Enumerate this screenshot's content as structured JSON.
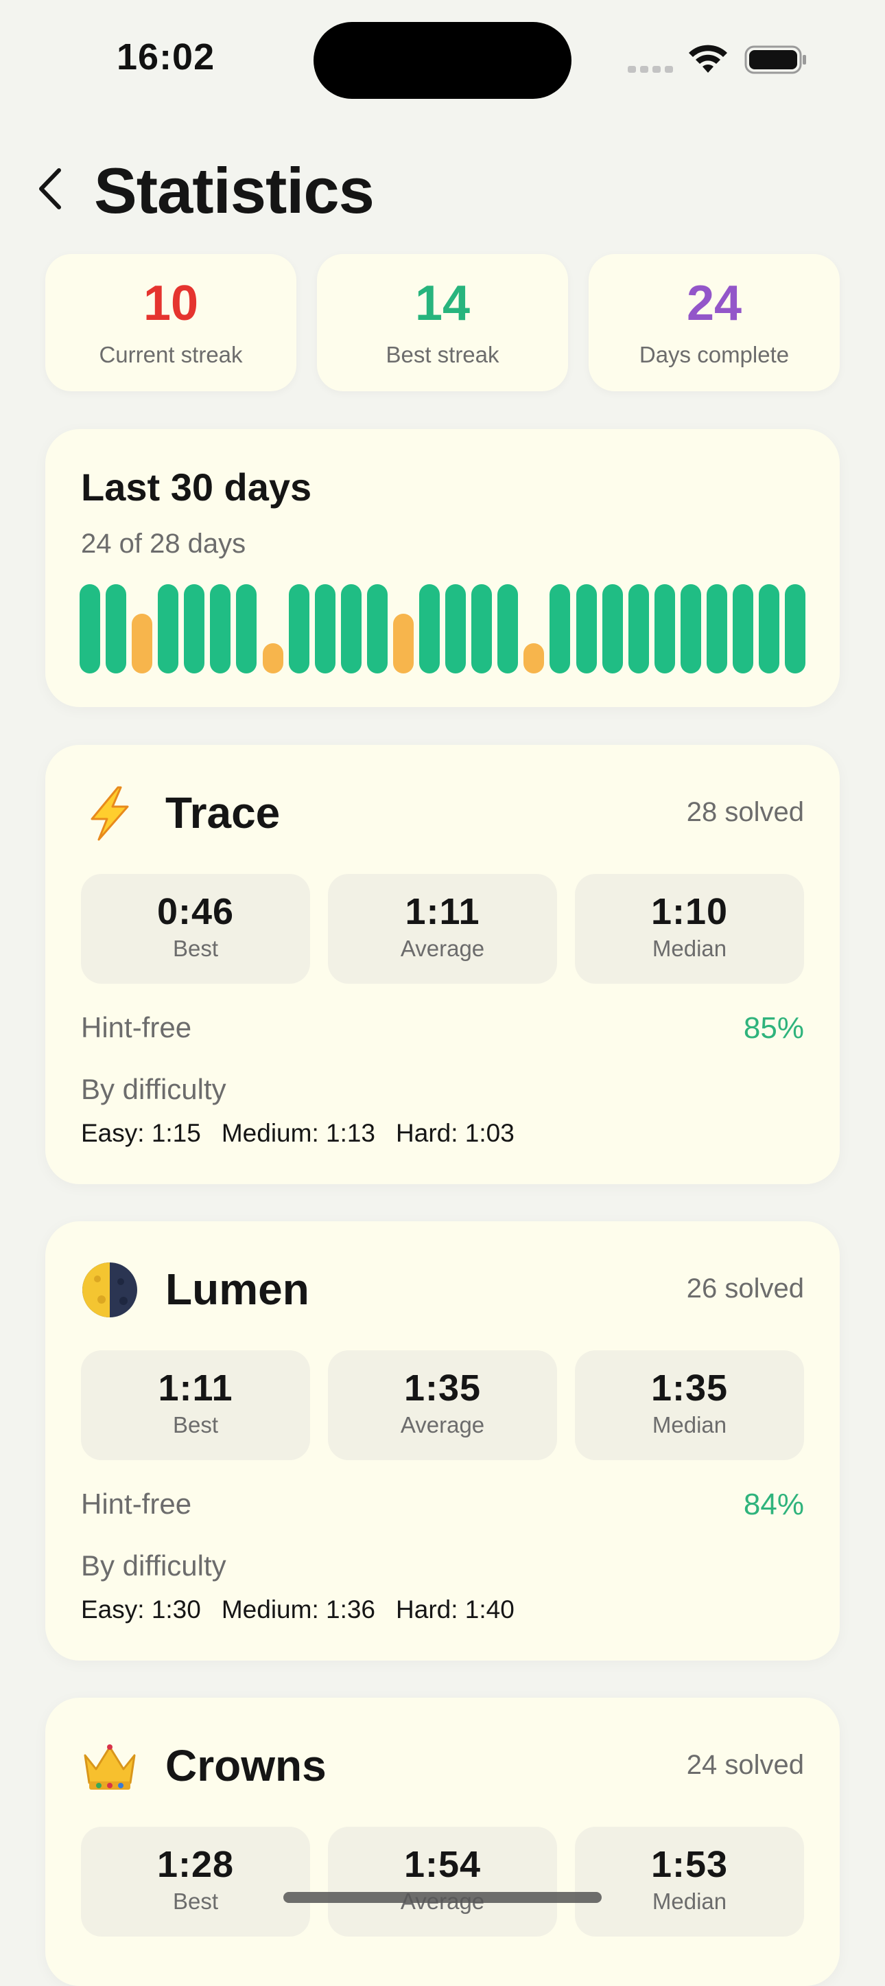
{
  "status_bar": {
    "time": "16:02"
  },
  "header": {
    "title": "Statistics",
    "back_icon": "chevron-left-icon"
  },
  "summary": [
    {
      "value": "10",
      "label": "Current streak",
      "color": "#e5342f"
    },
    {
      "value": "14",
      "label": "Best streak",
      "color": "#27b47d"
    },
    {
      "value": "24",
      "label": "Days complete",
      "color": "#9356c9"
    }
  ],
  "last30": {
    "title": "Last 30 days",
    "subtitle": "24 of 28 days",
    "bars": [
      "full",
      "full",
      "half",
      "full",
      "full",
      "full",
      "full",
      "half",
      "full",
      "full",
      "full",
      "full",
      "half",
      "full",
      "full",
      "full",
      "full",
      "half",
      "full",
      "full",
      "full",
      "full",
      "full",
      "full",
      "full",
      "full",
      "full",
      "full"
    ],
    "colors": {
      "full": "#20bd84",
      "half": "#f7b54c"
    }
  },
  "games": [
    {
      "icon": "lightning-icon",
      "name": "Trace",
      "solved": "28 solved",
      "stats": [
        {
          "value": "0:46",
          "label": "Best"
        },
        {
          "value": "1:11",
          "label": "Average"
        },
        {
          "value": "1:10",
          "label": "Median"
        }
      ],
      "hint_free_label": "Hint-free",
      "hint_free_value": "85%",
      "difficulty_label": "By difficulty",
      "difficulty": [
        "Easy: 1:15",
        "Medium: 1:13",
        "Hard: 1:03"
      ]
    },
    {
      "icon": "moon-icon",
      "name": "Lumen",
      "solved": "26 solved",
      "stats": [
        {
          "value": "1:11",
          "label": "Best"
        },
        {
          "value": "1:35",
          "label": "Average"
        },
        {
          "value": "1:35",
          "label": "Median"
        }
      ],
      "hint_free_label": "Hint-free",
      "hint_free_value": "84%",
      "difficulty_label": "By difficulty",
      "difficulty": [
        "Easy: 1:30",
        "Medium: 1:36",
        "Hard: 1:40"
      ]
    },
    {
      "icon": "crown-icon",
      "name": "Crowns",
      "solved": "24 solved",
      "stats": [
        {
          "value": "1:28",
          "label": "Best"
        },
        {
          "value": "1:54",
          "label": "Average"
        },
        {
          "value": "1:53",
          "label": "Median"
        }
      ]
    }
  ]
}
